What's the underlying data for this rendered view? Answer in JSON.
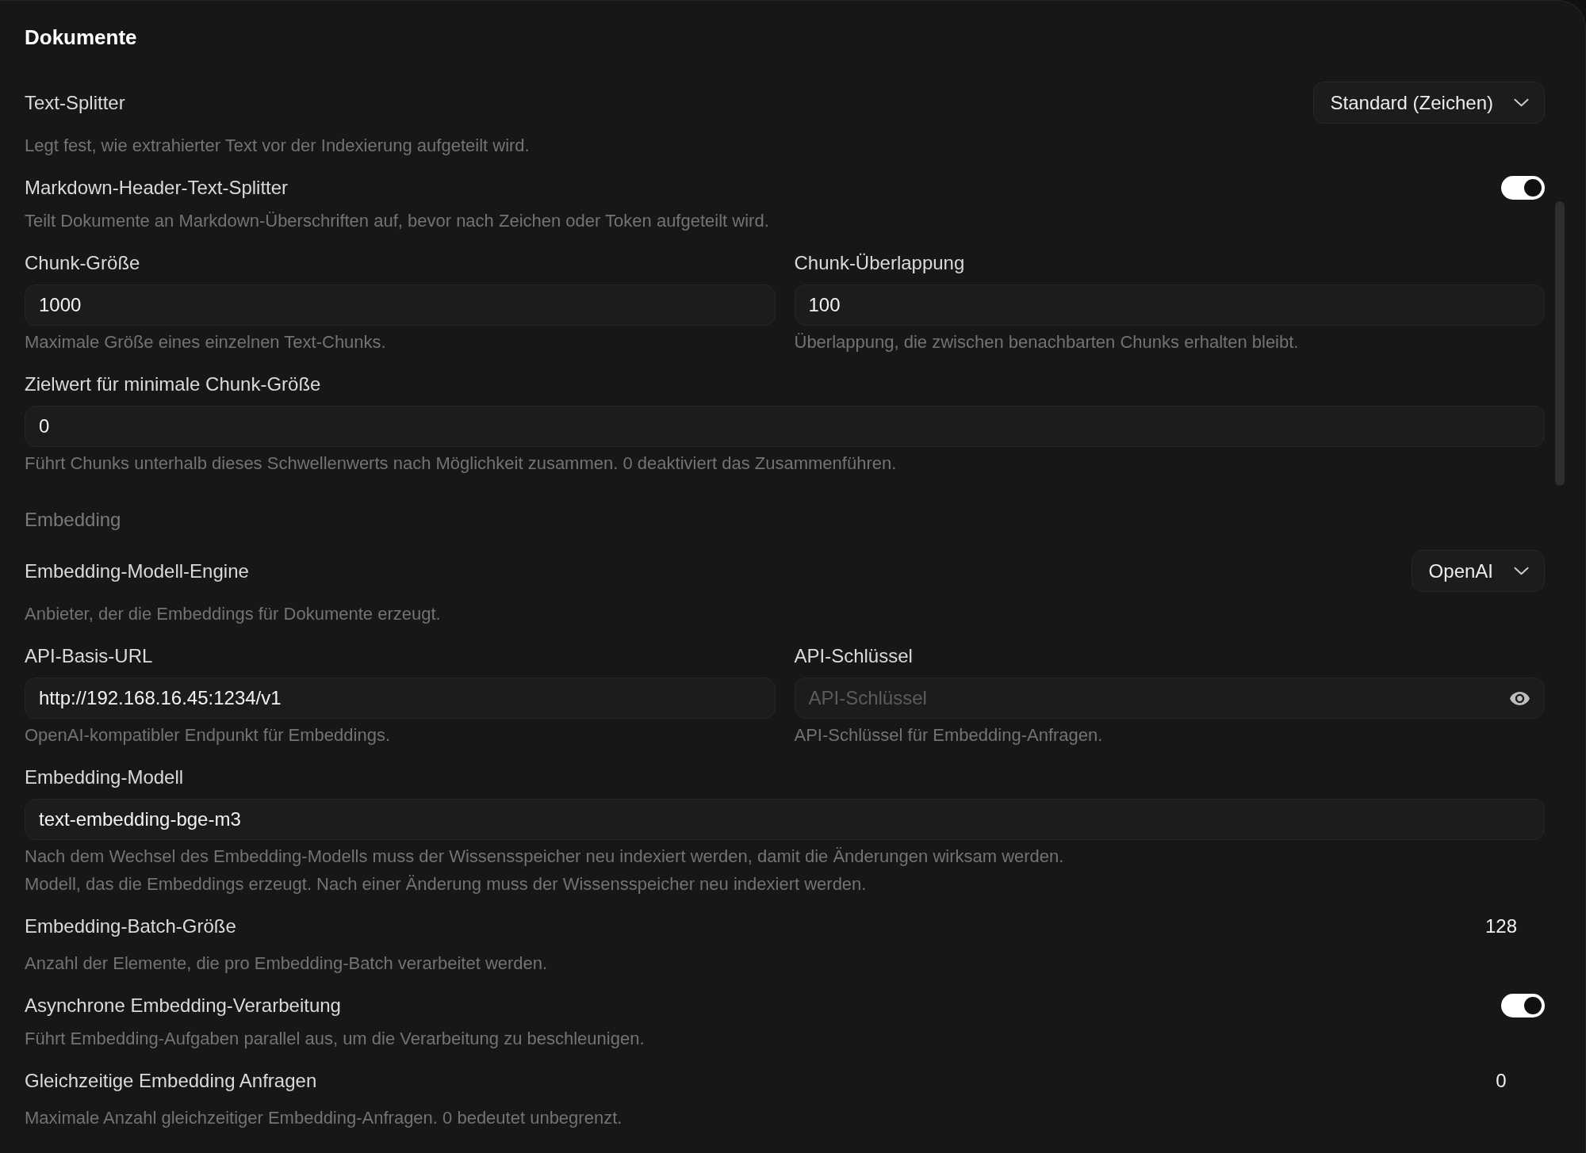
{
  "title": "Dokumente",
  "settings": [
    {
      "kind": "select",
      "label": "Text-Splitter",
      "value": "Standard (Zeichen)",
      "description": "Legt fest, wie extrahierter Text vor der Indexierung aufgeteilt wird."
    },
    {
      "kind": "toggle",
      "label": "Markdown-Header-Text-Splitter",
      "on": true,
      "description": "Teilt Dokumente an Markdown-Überschriften auf, bevor nach Zeichen oder Token aufgeteilt wird."
    },
    {
      "kind": "field_pair",
      "fields": [
        {
          "kind": "text",
          "label": "Chunk-Größe",
          "value": "1000",
          "description": "Maximale Größe eines einzelnen Text-Chunks."
        },
        {
          "kind": "text",
          "label": "Chunk-Überlappung",
          "value": "100",
          "description": "Überlappung, die zwischen benachbarten Chunks erhalten bleibt."
        }
      ]
    },
    {
      "kind": "field",
      "label": "Zielwert für minimale Chunk-Größe",
      "value": "0",
      "description": "Führt Chunks unterhalb dieses Schwellenwerts nach Möglichkeit zusammen. 0 deaktiviert das Zusammenführen."
    },
    {
      "kind": "section",
      "label": "Embedding"
    },
    {
      "kind": "select",
      "label": "Embedding-Modell-Engine",
      "value": "OpenAI",
      "description": "Anbieter, der die Embeddings für Dokumente erzeugt."
    },
    {
      "kind": "field_pair",
      "fields": [
        {
          "kind": "text",
          "label": "API-Basis-URL",
          "value": "http://192.168.16.45:1234/v1",
          "description": "OpenAI-kompatibler Endpunkt für Embeddings."
        },
        {
          "kind": "password",
          "label": "API-Schlüssel",
          "placeholder": "API-Schlüssel",
          "description": "API-Schlüssel für Embedding-Anfragen."
        }
      ]
    },
    {
      "kind": "field",
      "label": "Embedding-Modell",
      "value": "text-embedding-bge-m3",
      "description": [
        "Nach dem Wechsel des Embedding-Modells muss der Wissensspeicher neu indexiert werden, damit die Änderungen wirksam werden.",
        "Modell, das die Embeddings erzeugt. Nach einer Änderung muss der Wissensspeicher neu indexiert werden."
      ]
    },
    {
      "kind": "number",
      "label": "Embedding-Batch-Größe",
      "value": "128",
      "description": "Anzahl der Elemente, die pro Embedding-Batch verarbeitet werden."
    },
    {
      "kind": "toggle",
      "label": "Asynchrone Embedding-Verarbeitung",
      "on": true,
      "description": "Führt Embedding-Aufgaben parallel aus, um die Verarbeitung zu beschleunigen."
    },
    {
      "kind": "number",
      "label": "Gleichzeitige Embedding Anfragen",
      "value": "0",
      "description": "Maximale Anzahl gleichzeitiger Embedding-Anfragen. 0 bedeutet unbegrenzt."
    }
  ]
}
